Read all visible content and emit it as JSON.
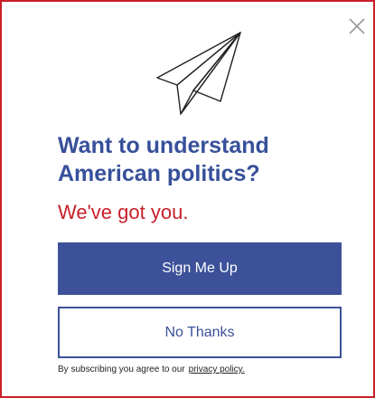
{
  "modal": {
    "headline_line1": "Want to understand",
    "headline_line2": "American politics?",
    "subhead": "We've got you.",
    "primary_button": "Sign Me Up",
    "secondary_button": "No Thanks",
    "disclaimer_text": "By subscribing you agree to our",
    "privacy_link": "privacy policy."
  },
  "icons": {
    "close": "close-icon",
    "hero": "paper-plane-icon"
  },
  "colors": {
    "border": "#c8202a",
    "headline": "#37509a",
    "subhead": "#c8202a",
    "primary": "#3c5199",
    "close": "#9a9a9a"
  }
}
